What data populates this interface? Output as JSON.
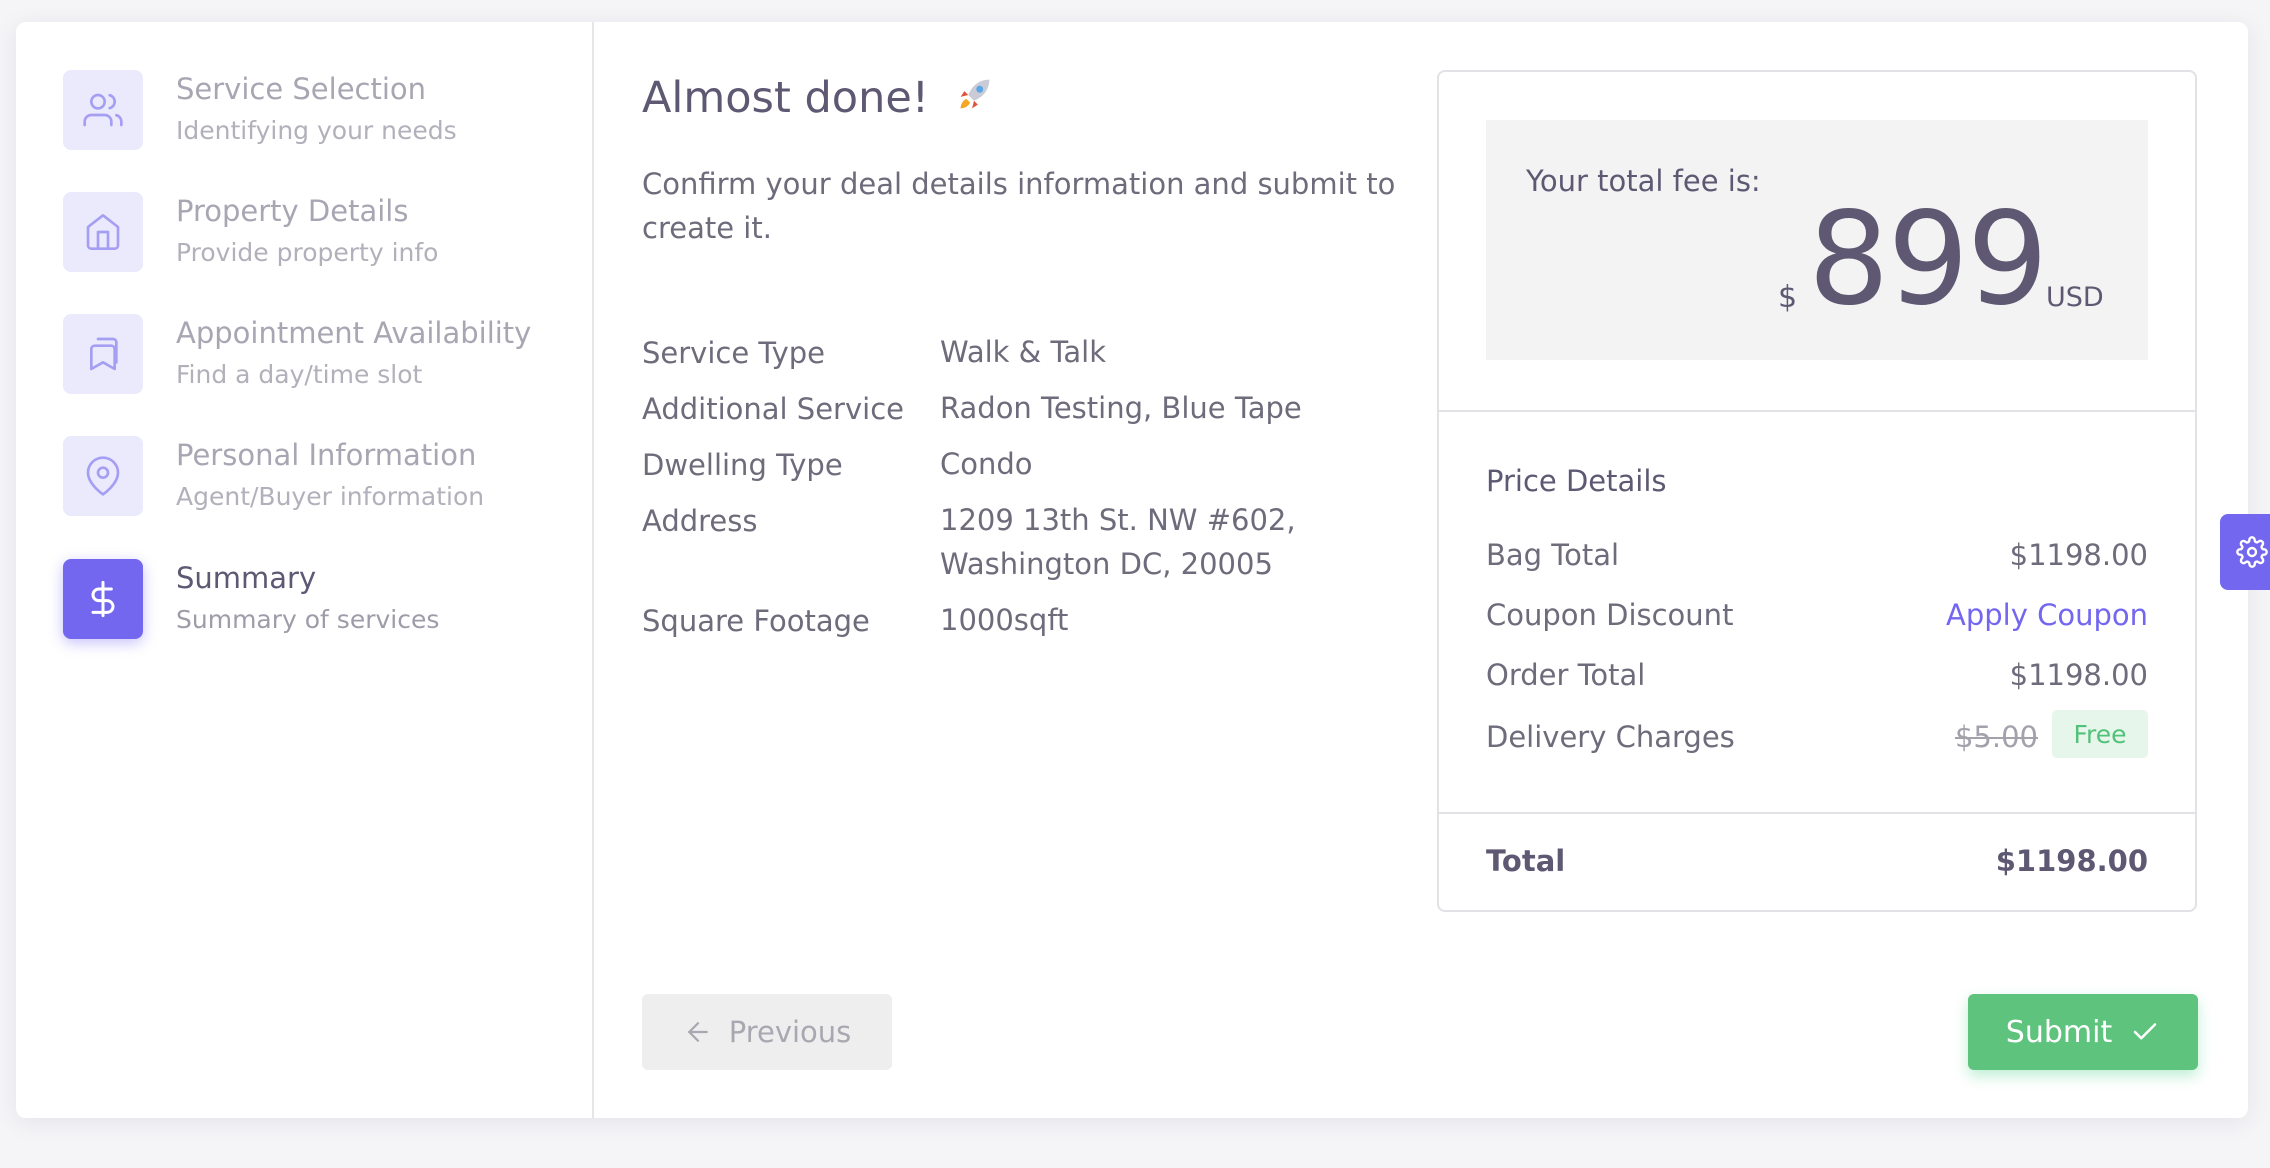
{
  "steps": [
    {
      "title": "Service Selection",
      "subtitle": "Identifying your needs",
      "icon": "users-icon"
    },
    {
      "title": "Property Details",
      "subtitle": "Provide property info",
      "icon": "home-icon"
    },
    {
      "title": "Appointment Availability",
      "subtitle": "Find a day/time slot",
      "icon": "bookmarks-icon"
    },
    {
      "title": "Personal Information",
      "subtitle": "Agent/Buyer information",
      "icon": "map-pin-icon"
    },
    {
      "title": "Summary",
      "subtitle": "Summary of services",
      "icon": "dollar-icon",
      "active": true
    }
  ],
  "main": {
    "headline": "Almost done!",
    "intro": "Confirm your deal details information and submit to create it.",
    "details": [
      {
        "label": "Service Type",
        "value": "Walk & Talk"
      },
      {
        "label": "Additional Service",
        "value": "Radon Testing, Blue Tape"
      },
      {
        "label": "Dwelling Type",
        "value": "Condo"
      },
      {
        "label": "Address",
        "value_lines": [
          "1209 13th St. NW #602,",
          "Washington DC, 20005"
        ]
      },
      {
        "label": "Square Footage",
        "value": "1000sqft"
      }
    ]
  },
  "fee": {
    "label": "Your total fee is:",
    "currency_symbol": "$",
    "amount": "899",
    "unit": "USD"
  },
  "price_details": {
    "title": "Price Details",
    "rows": [
      {
        "label": "Bag Total",
        "value": "$1198.00"
      },
      {
        "label": "Coupon Discount",
        "value": "Apply Coupon"
      },
      {
        "label": "Order Total",
        "value": "$1198.00"
      },
      {
        "label": "Delivery Charges",
        "old_value": "$5.00",
        "badge": "Free"
      }
    ],
    "total_label": "Total",
    "total_value": "$1198.00"
  },
  "buttons": {
    "previous": "Previous",
    "submit": "Submit"
  },
  "colors": {
    "accent": "#7367f0",
    "success": "#5ec37c",
    "badge_bg": "#e6f6ea"
  }
}
